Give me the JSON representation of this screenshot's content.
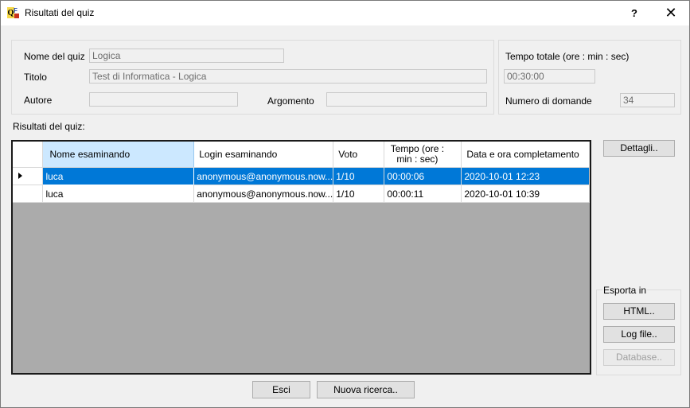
{
  "window": {
    "title": "Risultati del quiz",
    "help_label": "?",
    "close_label": "✕",
    "icon": "quiz-app-icon"
  },
  "info": {
    "quiz_name_label": "Nome del quiz",
    "quiz_name_value": "Logica",
    "title_label": "Titolo",
    "title_value": "Test di Informatica - Logica",
    "author_label": "Autore",
    "author_value": "",
    "topic_label": "Argomento",
    "topic_value": ""
  },
  "time": {
    "total_time_label": "Tempo totale (ore : min : sec)",
    "total_time_value": "00:30:00",
    "num_questions_label": "Numero di domande",
    "num_questions_value": "34"
  },
  "results": {
    "label": "Risultati del quiz:",
    "columns": [
      "Nome esaminando",
      "Login esaminando",
      "Voto",
      "Tempo (ore : min : sec)",
      "Data e ora completamento"
    ],
    "rows": [
      {
        "name": "luca",
        "login": "anonymous@anonymous.now...",
        "score": "1/10",
        "time": "00:00:06",
        "date": "2020-10-01 12:23"
      },
      {
        "name": "luca",
        "login": "anonymous@anonymous.now...",
        "score": "1/10",
        "time": "00:00:11",
        "date": "2020-10-01 10:39"
      }
    ]
  },
  "buttons": {
    "details": "Dettagli..",
    "export_label": "Esporta in",
    "html": "HTML..",
    "log_file": "Log file..",
    "database": "Database..",
    "exit": "Esci",
    "new_search": "Nuova ricerca.."
  },
  "colors": {
    "selection": "#0078d7",
    "header_selected": "#cce8ff",
    "grid_empty": "#ababab"
  }
}
